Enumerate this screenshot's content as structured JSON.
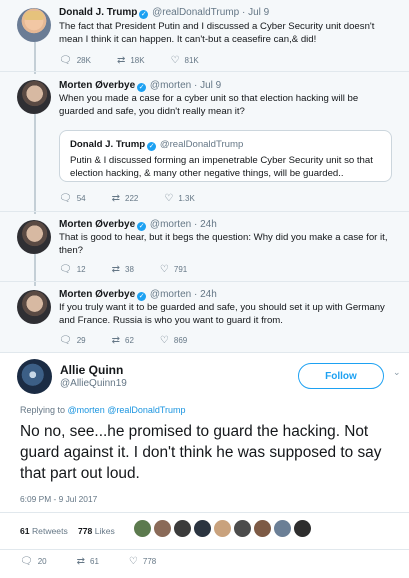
{
  "thread": [
    {
      "name": "Donald J. Trump",
      "handle": "@realDonaldTrump",
      "time": "Jul 9",
      "text": "The fact that President Putin and I discussed a Cyber Security unit  doesn't mean I think it can happen. It can't-but a ceasefire can,& did!",
      "replies": "28K",
      "retweets": "18K",
      "likes": "81K"
    },
    {
      "name": "Morten Øverbye",
      "handle": "@morten",
      "time": "Jul 9",
      "text": "When you made a case for a cyber unit so that election hacking will be guarded and safe, you didn't really mean it?",
      "quote": {
        "name": "Donald J. Trump",
        "handle": "@realDonaldTrump",
        "text": "Putin & I discussed forming an impenetrable Cyber Security unit    so that election hacking, & many other negative things, will be guarded.."
      },
      "replies": "54",
      "retweets": "222",
      "likes": "1.3K"
    },
    {
      "name": "Morten Øverbye",
      "handle": "@morten",
      "time": "24h",
      "text": "That is good to hear, but it begs the question: Why did you make a case for it, then?",
      "replies": "12",
      "retweets": "38",
      "likes": "791"
    },
    {
      "name": "Morten Øverbye",
      "handle": "@morten",
      "time": "24h",
      "text": "If you truly want it to be guarded and safe, you should set it up with Germany and France. Russia is who you want to guard it from.",
      "replies": "29",
      "retweets": "62",
      "likes": "869"
    }
  ],
  "main": {
    "name": "Allie Quinn",
    "handle": "@AllieQuinn19",
    "follow_label": "Follow",
    "replying_prefix": "Replying to",
    "replying_to": "@morten @realDonaldTrump",
    "text": "No no, see...he promised to guard the hacking. Not guard against it. I don't think he was supposed to say that part out loud.",
    "timestamp": "6:09 PM - 9 Jul 2017",
    "retweets_count": "61",
    "retweets_label": "Retweets",
    "likes_count": "778",
    "likes_label": "Likes",
    "liker_colors": [
      "#5c7a4e",
      "#8a6a58",
      "#3b3b3b",
      "#2b3440",
      "#c9a27d",
      "#4c4c4c",
      "#7d5a45",
      "#6b7f96",
      "#2e2e2e"
    ],
    "replies": "20",
    "retweets": "61",
    "likes": "778"
  },
  "icons": {
    "reply": "reply-icon",
    "retweet": "retweet-icon",
    "like": "heart-icon",
    "verified": "verified-badge-icon",
    "chevron": "chevron-down-icon"
  },
  "colors": {
    "accent": "#1da1f2",
    "link": "#1b95e0",
    "thread_bg": "#f5f8fa",
    "muted": "#657786"
  }
}
